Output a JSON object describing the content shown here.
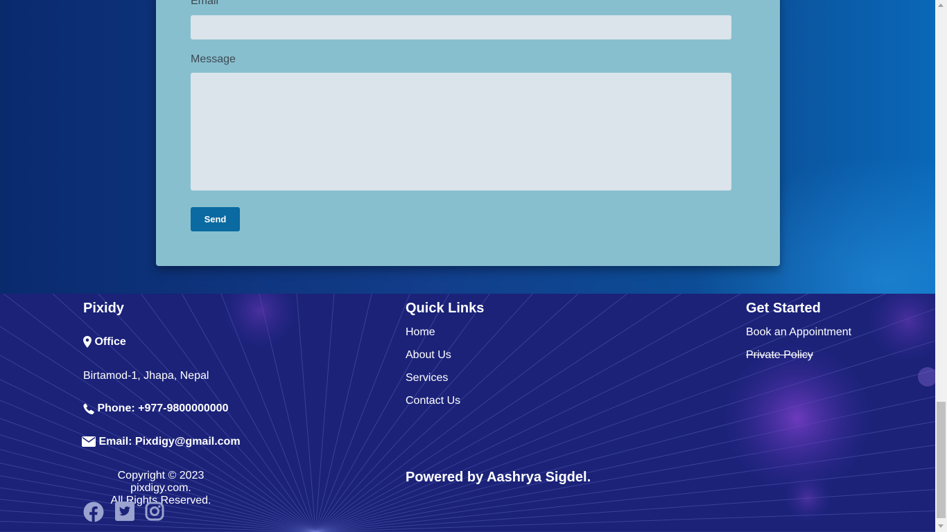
{
  "form": {
    "email_label": "Email",
    "email_value": "",
    "message_label": "Message",
    "message_value": "",
    "send_label": "Send"
  },
  "footer": {
    "brand": "Pixidy",
    "office_label": "Office",
    "address": "Birtamod-1, Jhapa, Nepal",
    "phone": "Phone: +977-9800000000",
    "email": "Email: Pixdigy@gmail.com",
    "copyright_line1": "Copyright © 2023 pixdigy.com.",
    "copyright_line2": "All Rights Reserved.",
    "quick_links_title": "Quick Links",
    "quick_links": [
      "Home",
      "About Us",
      "Services",
      "Contact Us"
    ],
    "powered_by": "Powered by Aashrya Sigdel.",
    "get_started_title": "Get Started",
    "get_started_links": [
      "Book an Appointment",
      "Private Policy"
    ],
    "social_icons": [
      "facebook-icon",
      "twitter-icon",
      "instagram-icon"
    ]
  },
  "colors": {
    "form_card": "#88bfcf",
    "send_button": "#0a6aa1",
    "footer_bg": "#1b2278"
  }
}
